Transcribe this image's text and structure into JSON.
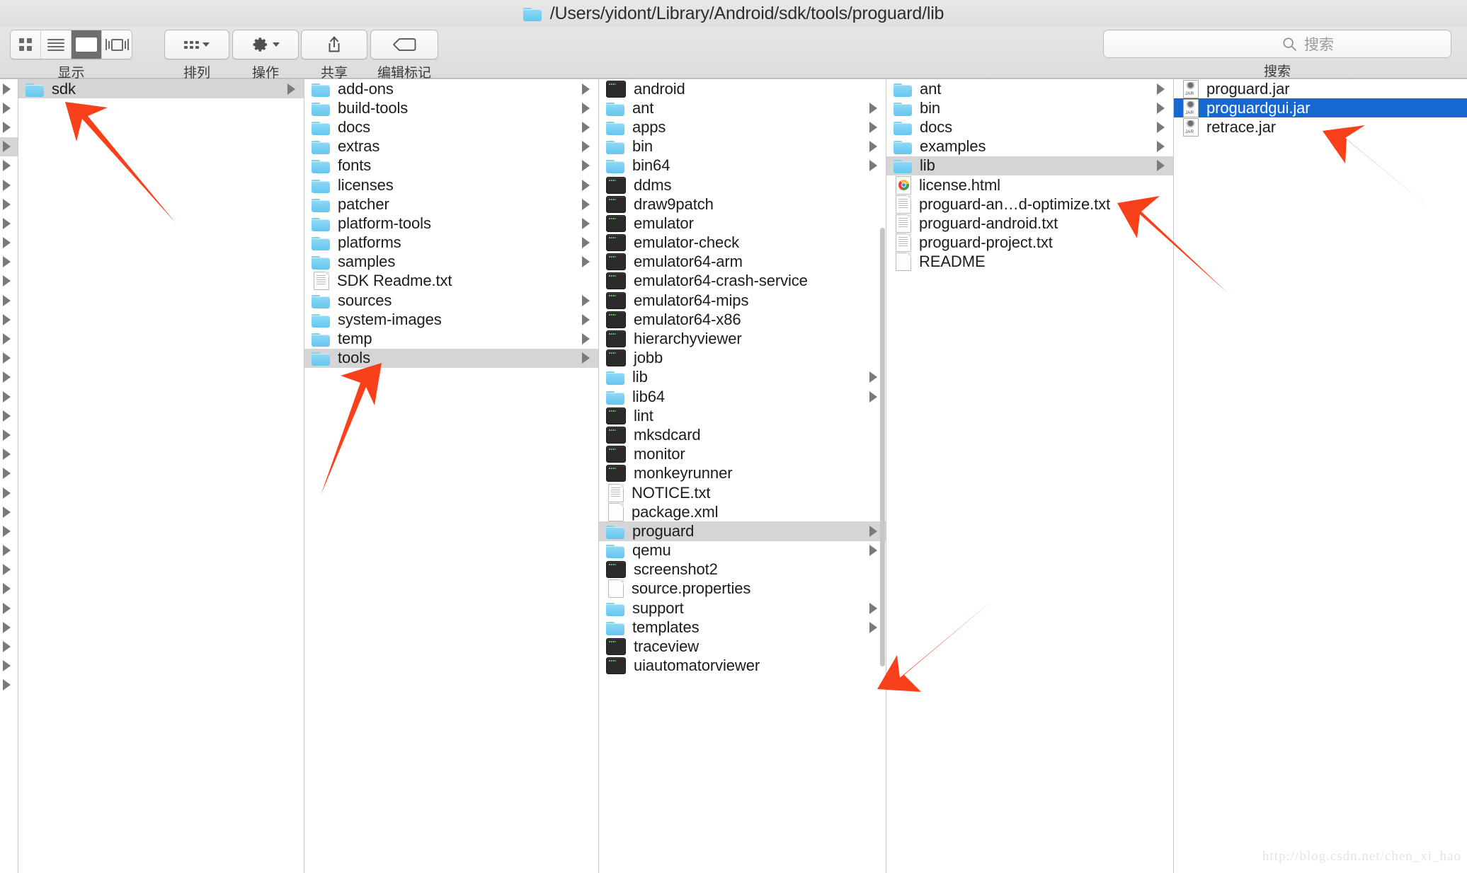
{
  "window": {
    "title": "/Users/yidont/Library/Android/sdk/tools/proguard/lib",
    "title_icon": "folder-icon"
  },
  "toolbar": {
    "view_group_label": "显示",
    "view_modes": [
      {
        "name": "icon-view",
        "icon": "grid-icon",
        "active": false
      },
      {
        "name": "list-view",
        "icon": "list-icon",
        "active": false
      },
      {
        "name": "column-view",
        "icon": "columns-icon",
        "active": true
      },
      {
        "name": "coverflow-view",
        "icon": "coverflow-icon",
        "active": false
      }
    ],
    "arrange_label": "排列",
    "arrange_icon": "arrange-grid-icon",
    "action_label": "操作",
    "action_icon": "gear-icon",
    "share_label": "共享",
    "share_icon": "share-up-arrow-icon",
    "tags_label": "编辑标记",
    "tags_icon": "tag-icon"
  },
  "search": {
    "label": "搜索",
    "placeholder": "搜索",
    "icon": "search-icon",
    "value": ""
  },
  "selection_color": "#1767d1",
  "columns": [
    {
      "name": "column-stub",
      "kind": "stub",
      "rows_count": 32,
      "highlighted_index": 3
    },
    {
      "name": "column-sdk",
      "items": [
        {
          "label": "sdk",
          "type": "folder",
          "expandable": true,
          "state": "selected-inactive"
        }
      ]
    },
    {
      "name": "column-sdk-contents",
      "items": [
        {
          "label": "add-ons",
          "type": "folder",
          "expandable": true,
          "state": "normal"
        },
        {
          "label": "build-tools",
          "type": "folder",
          "expandable": true,
          "state": "normal"
        },
        {
          "label": "docs",
          "type": "folder",
          "expandable": true,
          "state": "normal"
        },
        {
          "label": "extras",
          "type": "folder",
          "expandable": true,
          "state": "normal"
        },
        {
          "label": "fonts",
          "type": "folder",
          "expandable": true,
          "state": "normal"
        },
        {
          "label": "licenses",
          "type": "folder",
          "expandable": true,
          "state": "normal"
        },
        {
          "label": "patcher",
          "type": "folder",
          "expandable": true,
          "state": "normal"
        },
        {
          "label": "platform-tools",
          "type": "folder",
          "expandable": true,
          "state": "normal"
        },
        {
          "label": "platforms",
          "type": "folder",
          "expandable": true,
          "state": "normal"
        },
        {
          "label": "samples",
          "type": "folder",
          "expandable": true,
          "state": "normal"
        },
        {
          "label": "SDK Readme.txt",
          "type": "document",
          "expandable": false,
          "state": "normal"
        },
        {
          "label": "sources",
          "type": "folder",
          "expandable": true,
          "state": "normal"
        },
        {
          "label": "system-images",
          "type": "folder",
          "expandable": true,
          "state": "normal"
        },
        {
          "label": "temp",
          "type": "folder",
          "expandable": true,
          "state": "normal"
        },
        {
          "label": "tools",
          "type": "folder",
          "expandable": true,
          "state": "selected-inactive"
        }
      ]
    },
    {
      "name": "column-tools-contents",
      "items": [
        {
          "label": "android",
          "type": "executable",
          "expandable": false,
          "state": "normal"
        },
        {
          "label": "ant",
          "type": "folder",
          "expandable": true,
          "state": "normal"
        },
        {
          "label": "apps",
          "type": "folder",
          "expandable": true,
          "state": "normal"
        },
        {
          "label": "bin",
          "type": "folder",
          "expandable": true,
          "state": "normal"
        },
        {
          "label": "bin64",
          "type": "folder",
          "expandable": true,
          "state": "normal"
        },
        {
          "label": "ddms",
          "type": "executable",
          "expandable": false,
          "state": "normal"
        },
        {
          "label": "draw9patch",
          "type": "executable",
          "expandable": false,
          "state": "normal"
        },
        {
          "label": "emulator",
          "type": "executable",
          "expandable": false,
          "state": "normal"
        },
        {
          "label": "emulator-check",
          "type": "executable",
          "expandable": false,
          "state": "normal"
        },
        {
          "label": "emulator64-arm",
          "type": "executable",
          "expandable": false,
          "state": "normal"
        },
        {
          "label": "emulator64-crash-service",
          "type": "executable",
          "expandable": false,
          "state": "normal"
        },
        {
          "label": "emulator64-mips",
          "type": "executable",
          "expandable": false,
          "state": "normal"
        },
        {
          "label": "emulator64-x86",
          "type": "executable",
          "expandable": false,
          "state": "normal"
        },
        {
          "label": "hierarchyviewer",
          "type": "executable",
          "expandable": false,
          "state": "normal"
        },
        {
          "label": "jobb",
          "type": "executable",
          "expandable": false,
          "state": "normal"
        },
        {
          "label": "lib",
          "type": "folder",
          "expandable": true,
          "state": "normal"
        },
        {
          "label": "lib64",
          "type": "folder",
          "expandable": true,
          "state": "normal"
        },
        {
          "label": "lint",
          "type": "executable",
          "expandable": false,
          "state": "normal"
        },
        {
          "label": "mksdcard",
          "type": "executable",
          "expandable": false,
          "state": "normal"
        },
        {
          "label": "monitor",
          "type": "executable",
          "expandable": false,
          "state": "normal"
        },
        {
          "label": "monkeyrunner",
          "type": "executable",
          "expandable": false,
          "state": "normal"
        },
        {
          "label": "NOTICE.txt",
          "type": "document",
          "expandable": false,
          "state": "normal"
        },
        {
          "label": "package.xml",
          "type": "blank-document",
          "expandable": false,
          "state": "normal"
        },
        {
          "label": "proguard",
          "type": "folder",
          "expandable": true,
          "state": "selected-inactive"
        },
        {
          "label": "qemu",
          "type": "folder",
          "expandable": true,
          "state": "normal"
        },
        {
          "label": "screenshot2",
          "type": "executable",
          "expandable": false,
          "state": "normal"
        },
        {
          "label": "source.properties",
          "type": "blank-document",
          "expandable": false,
          "state": "normal"
        },
        {
          "label": "support",
          "type": "folder",
          "expandable": true,
          "state": "normal"
        },
        {
          "label": "templates",
          "type": "folder",
          "expandable": true,
          "state": "normal"
        },
        {
          "label": "traceview",
          "type": "executable",
          "expandable": false,
          "state": "normal"
        },
        {
          "label": "uiautomatorviewer",
          "type": "executable",
          "expandable": false,
          "state": "normal"
        }
      ]
    },
    {
      "name": "column-proguard-contents",
      "items": [
        {
          "label": "ant",
          "type": "folder",
          "expandable": true,
          "state": "normal"
        },
        {
          "label": "bin",
          "type": "folder",
          "expandable": true,
          "state": "normal"
        },
        {
          "label": "docs",
          "type": "folder",
          "expandable": true,
          "state": "normal"
        },
        {
          "label": "examples",
          "type": "folder",
          "expandable": true,
          "state": "normal"
        },
        {
          "label": "lib",
          "type": "folder",
          "expandable": true,
          "state": "selected-inactive"
        },
        {
          "label": "license.html",
          "type": "chrome-document",
          "expandable": false,
          "state": "normal"
        },
        {
          "label": "proguard-an…d-optimize.txt",
          "type": "document",
          "expandable": false,
          "state": "normal"
        },
        {
          "label": "proguard-android.txt",
          "type": "document",
          "expandable": false,
          "state": "normal"
        },
        {
          "label": "proguard-project.txt",
          "type": "document",
          "expandable": false,
          "state": "normal"
        },
        {
          "label": "README",
          "type": "blank-document",
          "expandable": false,
          "state": "normal"
        }
      ]
    },
    {
      "name": "column-lib-contents",
      "items": [
        {
          "label": "proguard.jar",
          "type": "jar",
          "expandable": false,
          "state": "normal"
        },
        {
          "label": "proguardgui.jar",
          "type": "jar",
          "expandable": false,
          "state": "selected-active"
        },
        {
          "label": "retrace.jar",
          "type": "jar",
          "expandable": false,
          "state": "normal"
        }
      ]
    }
  ],
  "annotations": {
    "arrow_color": "#f8401a",
    "arrows": [
      {
        "name": "arrow-to-sdk",
        "target": "sdk"
      },
      {
        "name": "arrow-to-tools",
        "target": "tools"
      },
      {
        "name": "arrow-to-proguard",
        "target": "proguard"
      },
      {
        "name": "arrow-to-lib",
        "target": "lib"
      },
      {
        "name": "arrow-to-proguardgui-jar",
        "target": "proguardgui.jar"
      }
    ]
  },
  "watermark": {
    "text": "http://blog.csdn.net/chen_xi_hao"
  }
}
